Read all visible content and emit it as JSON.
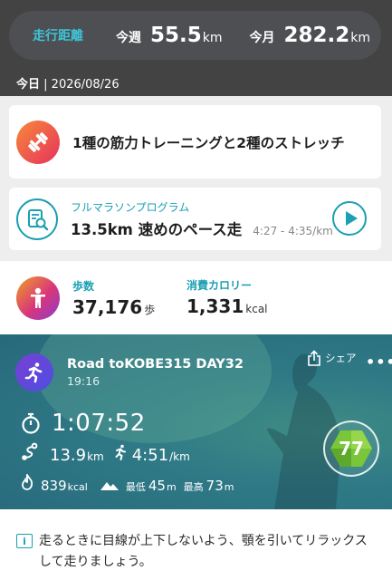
{
  "summary": {
    "label": "走行距離",
    "week_label": "今週",
    "week_value": "55.5",
    "week_unit": "km",
    "month_label": "今月",
    "month_value": "282.2",
    "month_unit": "km"
  },
  "today": {
    "label": "今日",
    "separator": " | ",
    "date": "2026/08/26"
  },
  "workout": {
    "icon": "dumbbell-icon",
    "text": "1種の筋力トレーニングと2種のストレッチ"
  },
  "program": {
    "icon": "program-search-icon",
    "subtitle": "フルマラソンプログラム",
    "title": "13.5km 速めのペース走",
    "pace": "4:27 - 4:35/km"
  },
  "steps": {
    "icon": "body-icon",
    "label": "歩数",
    "value": "37,176",
    "unit": "歩",
    "cal_label": "消費カロリー",
    "cal_value": "1,331",
    "cal_unit": "kcal"
  },
  "activity": {
    "title": "Road toKOBE315 DAY32",
    "time": "19:16",
    "share_label": "シェア",
    "more_label": "•••",
    "duration": "1:07:52",
    "distance": "13.9",
    "distance_unit": "km",
    "pace": "4:51",
    "pace_unit": "/km",
    "calories": "839",
    "calories_unit": "kcal",
    "elev_min_label": "最低",
    "elev_min": "45",
    "elev_min_unit": "m",
    "elev_max_label": "最高",
    "elev_max": "73",
    "elev_max_unit": "m",
    "score": "77"
  },
  "tip": {
    "icon_glyph": "i",
    "text": "走るときに目線が上下しないよう、顎を引いてリラックスして走りましょう。"
  },
  "colors": {
    "accent": "#1a9fb3",
    "header": "#434343",
    "score": "#7ac63a"
  }
}
